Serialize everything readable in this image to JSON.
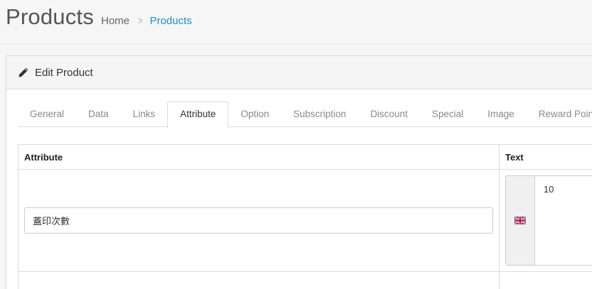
{
  "header": {
    "title": "Products",
    "breadcrumb": {
      "home": "Home",
      "current": "Products"
    }
  },
  "card": {
    "title": "Edit Product",
    "icon": "pencil-icon"
  },
  "tabs": [
    {
      "label": "General"
    },
    {
      "label": "Data"
    },
    {
      "label": "Links"
    },
    {
      "label": "Attribute",
      "active": true
    },
    {
      "label": "Option"
    },
    {
      "label": "Subscription"
    },
    {
      "label": "Discount"
    },
    {
      "label": "Special"
    },
    {
      "label": "Image"
    },
    {
      "label": "Reward Points"
    }
  ],
  "attribute_table": {
    "headers": {
      "attribute": "Attribute",
      "text": "Text"
    },
    "rows": [
      {
        "attribute": "蓋印次數",
        "language_flag": "uk-flag-icon",
        "text": "10"
      }
    ]
  },
  "colors": {
    "link": "#1e91cf",
    "border": "#dcdcdc",
    "header_bg": "#f5f5f5"
  }
}
